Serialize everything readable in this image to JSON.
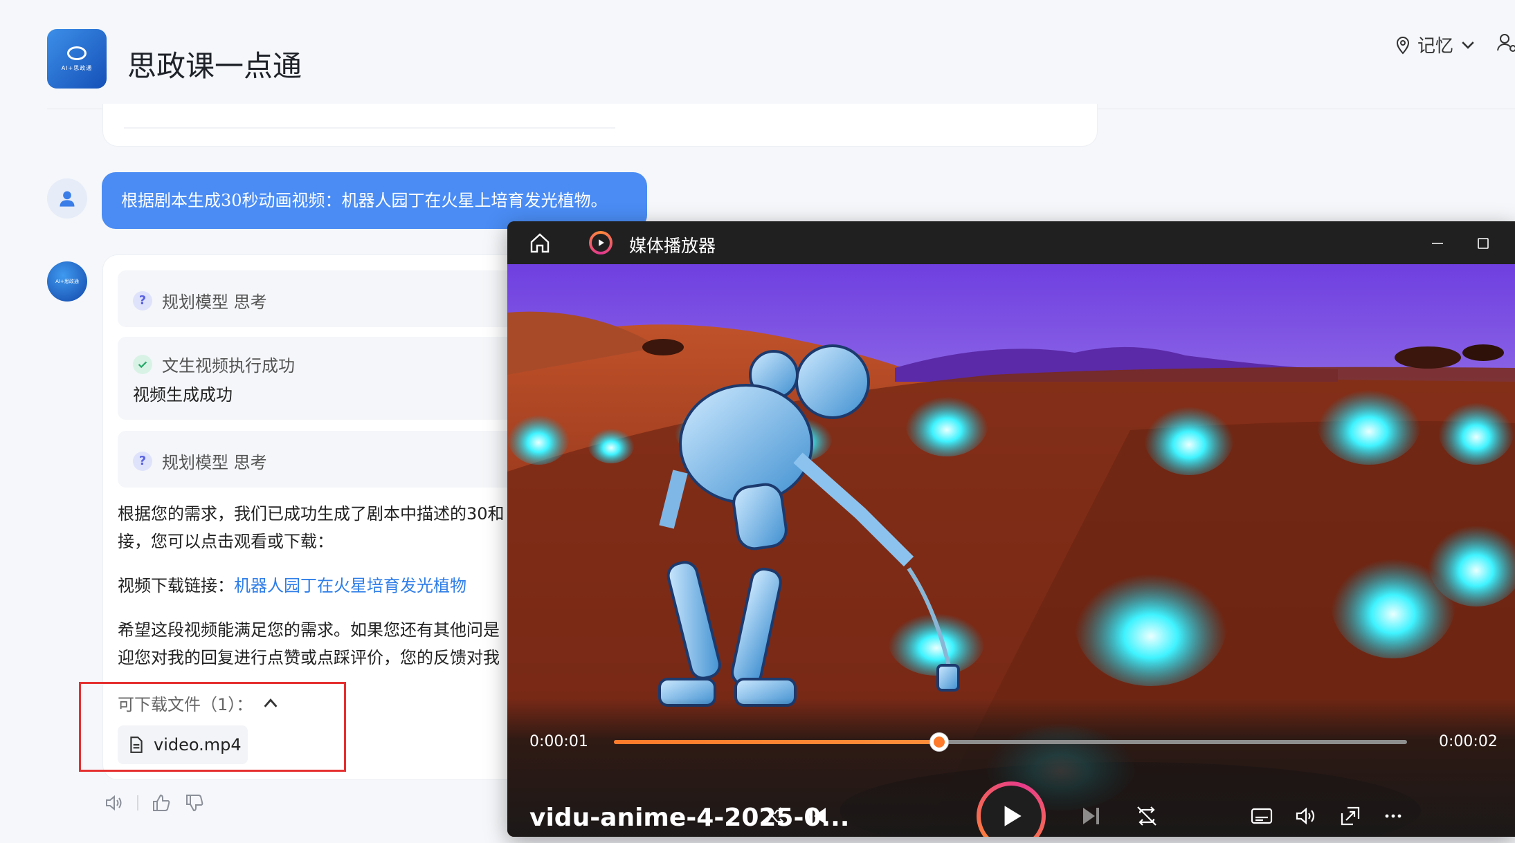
{
  "app": {
    "title": "思政课一点通",
    "logo_text": "AI+思政通",
    "memory_label": "记忆"
  },
  "chat": {
    "user_message": "根据剧本生成30秒动画视频：机器人园丁在火星上培育发光植物。",
    "steps": [
      {
        "icon": "question-icon",
        "label": "规划模型 思考"
      },
      {
        "icon": "check-circle-icon",
        "label": "文生视频执行成功",
        "detail": "视频生成成功"
      },
      {
        "icon": "question-icon",
        "label": "规划模型 思考"
      }
    ],
    "reply_line1": "根据您的需求，我们已成功生成了剧本中描述的30和",
    "reply_line2": "接，您可以点击观看或下载：",
    "download_prefix": "视频下载链接：",
    "download_link": "机器人园丁在火星培育发光植物",
    "reply_line3": "希望这段视频能满足您的需求。如果您还有其他问是",
    "reply_line4": "迎您对我的回复进行点赞或点踩评价，您的反馈对我",
    "files_label": "可下载文件（1）：",
    "file_name": "video.mp4",
    "highlight_color": "#e53030",
    "accent_color": "#4a8cf4"
  },
  "player": {
    "window_title": "媒体播放器",
    "current_time": "0:00:01",
    "total_time": "0:00:02",
    "progress": 0.41,
    "media_title": "vidu-anime-4-2025-0...",
    "accent_color": "#ff7a2a"
  }
}
